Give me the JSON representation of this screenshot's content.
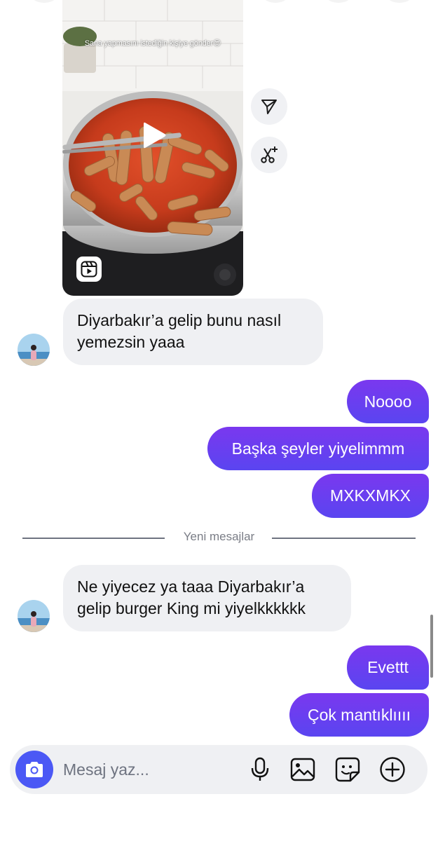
{
  "reel": {
    "caption": "Sana yapmasını istediğin kişiye gönder😍",
    "play_icon": "play-icon",
    "badge_icon": "reels-icon"
  },
  "side_actions": [
    {
      "icon": "send-icon"
    },
    {
      "icon": "remix-icon"
    }
  ],
  "messages": {
    "m1": {
      "line1": "Diyarbakır’a gelip bunu nasıl",
      "line2": "yemezsin yaaa"
    },
    "m2": "Noooo",
    "m3": "Başka şeyler yiyelimmm",
    "m4": "MXKXMKX",
    "divider": "Yeni mesajlar",
    "m5": {
      "line1": "Ne yiyecez ya taaa Diyarbakır’a",
      "line2": "gelip burger King mi yiyelkkkkkk"
    },
    "m6": "Evettt",
    "m7": "Çok mantıklıııı"
  },
  "composer": {
    "placeholder": "Mesaj yaz...",
    "icons": [
      "camera-icon",
      "microphone-icon",
      "gallery-icon",
      "sticker-icon",
      "plus-icon"
    ]
  },
  "colors": {
    "outgoing": "#6b3ff0",
    "incoming": "#eff0f3",
    "camera_button": "#4b58f5"
  }
}
